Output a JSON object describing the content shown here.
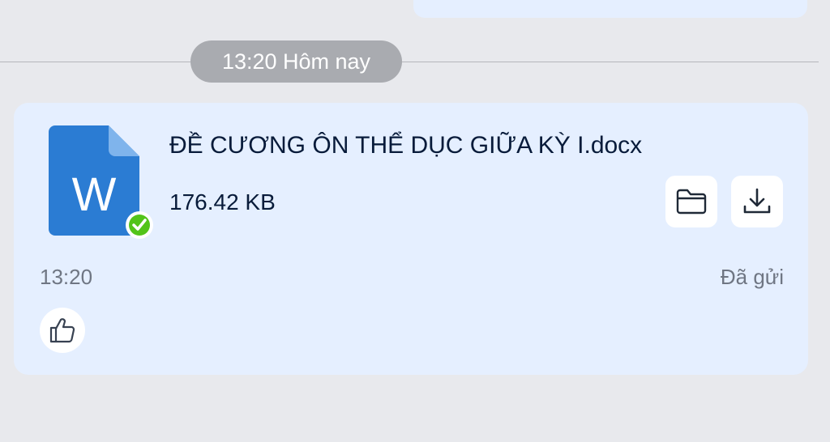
{
  "divider": {
    "time_label": "13:20 Hôm nay"
  },
  "message": {
    "file_name": "ĐỀ CƯƠNG ÔN THỂ DỤC GIỮA KỲ I.docx",
    "file_size": "176.42 KB",
    "file_type_letter": "W",
    "time": "13:20",
    "status": "Đã gửi",
    "icons": {
      "file": "word-doc-icon",
      "check": "check-badge-icon",
      "folder": "folder-icon",
      "download": "download-icon",
      "like": "thumbs-up-icon"
    },
    "colors": {
      "word_blue": "#2b7cd3",
      "check_green": "#52c41a",
      "bubble": "#e5efff"
    }
  }
}
